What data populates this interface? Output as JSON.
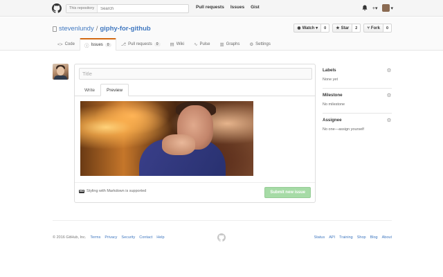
{
  "topbar": {
    "search_scope": "This repository",
    "search_placeholder": "Search",
    "nav": [
      "Pull requests",
      "Issues",
      "Gist"
    ],
    "plus_label": "+▾",
    "bell_icon": "bell-icon"
  },
  "repo": {
    "owner": "stevenlundy",
    "separator": "/",
    "name": "giphy-for-github",
    "actions": [
      {
        "label": "Watch ▾",
        "count": "0",
        "icon": "eye-icon"
      },
      {
        "label": "Star",
        "count": "2",
        "icon": "star-icon"
      },
      {
        "label": "Fork",
        "count": "0",
        "icon": "fork-icon"
      }
    ],
    "nav": [
      {
        "label": "Code",
        "icon": "<>",
        "counter": ""
      },
      {
        "label": "Issues",
        "icon": "ⓘ",
        "counter": "0"
      },
      {
        "label": "Pull requests",
        "icon": "⎇",
        "counter": "0"
      },
      {
        "label": "Wiki",
        "icon": "▤",
        "counter": ""
      },
      {
        "label": "Pulse",
        "icon": "∿",
        "counter": ""
      },
      {
        "label": "Graphs",
        "icon": "▥",
        "counter": ""
      },
      {
        "label": "Settings",
        "icon": "⚙",
        "counter": ""
      }
    ]
  },
  "composer": {
    "title_placeholder": "Title",
    "tab_write": "Write",
    "tab_preview": "Preview",
    "markdown_note": "Styling with Markdown is supported",
    "markdown_badge": "MD",
    "submit_label": "Submit new issue"
  },
  "sidebar": {
    "labels_heading": "Labels",
    "labels_value": "None yet",
    "milestone_heading": "Milestone",
    "milestone_value": "No milestone",
    "assignee_heading": "Assignee",
    "assignee_value": "No one—assign yourself"
  },
  "footer": {
    "copyright": "© 2016 GitHub, Inc.",
    "left_links": [
      "Terms",
      "Privacy",
      "Security",
      "Contact",
      "Help"
    ],
    "right_links": [
      "Status",
      "API",
      "Training",
      "Shop",
      "Blog",
      "About"
    ]
  },
  "colors": {
    "accent_orange": "#d26911",
    "link_blue": "#4078c0",
    "submit_green_disabled": "#a6dba6"
  }
}
